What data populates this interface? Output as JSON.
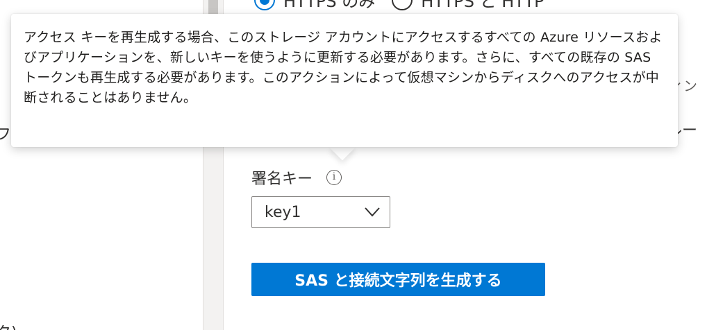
{
  "sidebar": {
    "fragments": [
      "フ",
      "タ)"
    ]
  },
  "permissions": {
    "radio_options": [
      {
        "label": "HTTPS のみ",
        "checked": true
      },
      {
        "label": "HTTPS と HTTP",
        "checked": false
      }
    ]
  },
  "right_fragments": [
    "ィン",
    "ルー"
  ],
  "signing_key": {
    "label": "署名キー",
    "info_icon": "info-icon",
    "selected": "key1",
    "dropdown_icon": "chevron-down-icon"
  },
  "actions": {
    "generate_label": "SAS と接続文字列を生成する"
  },
  "tooltip": {
    "text": "アクセス キーを再生成する場合、このストレージ アカウントにアクセスするすべての Azure リソースおよびアプリケーションを、新しいキーを使うように更新する必要があります。さらに、すべての既存の SAS トークンも再生成する必要があります。このアクションによって仮想マシンからディスクへのアクセスが中断されることはありません。"
  },
  "colors": {
    "accent": "#0078d4",
    "text": "#323130",
    "border": "#8a8886"
  }
}
